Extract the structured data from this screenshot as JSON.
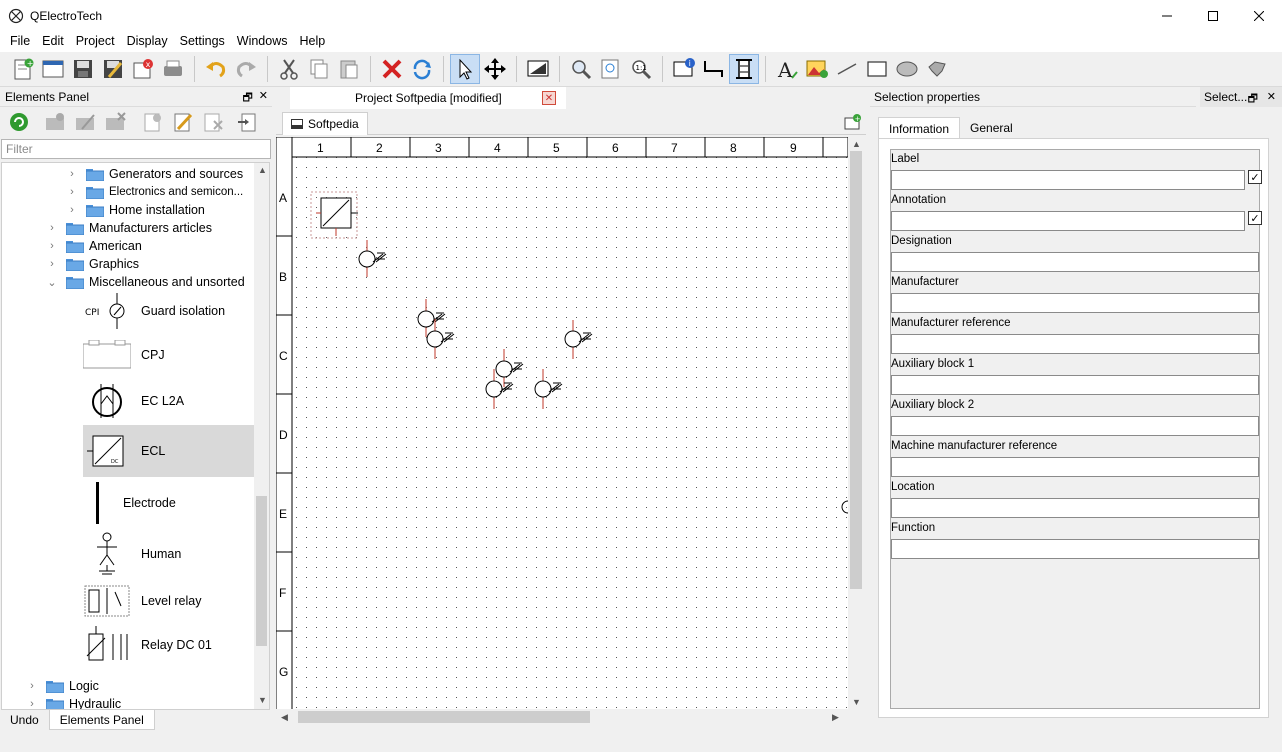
{
  "window": {
    "title": "QElectroTech"
  },
  "menu": [
    "File",
    "Edit",
    "Project",
    "Display",
    "Settings",
    "Windows",
    "Help"
  ],
  "toolbar": {
    "buttons": [
      "new-project-icon",
      "new-folio-icon",
      "save-icon",
      "save-as-icon",
      "close-icon",
      "print-icon",
      "undo-icon",
      "redo-icon",
      "cut-icon",
      "copy-icon",
      "paste-icon",
      "delete-icon",
      "rotate-icon",
      "select-icon",
      "move-icon",
      "fit-icon",
      "zoom-fit-icon",
      "zoom-reset-icon",
      "zoom-in-icon",
      "info-icon",
      "conductor-icon",
      "terminal-icon",
      "text-icon",
      "image-icon",
      "line-icon",
      "rectangle-icon",
      "ellipse-icon",
      "polygon-icon"
    ]
  },
  "elements_panel": {
    "title": "Elements Panel",
    "filter_placeholder": "Filter",
    "folders": [
      {
        "label": "Generators and sources",
        "level": 2,
        "expanded": false
      },
      {
        "label": "Electronics and semicon...",
        "level": 2,
        "expanded": false
      },
      {
        "label": "Home installation",
        "level": 2,
        "expanded": false
      },
      {
        "label": "Manufacturers articles",
        "level": 1,
        "expanded": false
      },
      {
        "label": "American",
        "level": 1,
        "expanded": false
      },
      {
        "label": "Graphics",
        "level": 1,
        "expanded": false
      },
      {
        "label": "Miscellaneous and unsorted",
        "level": 1,
        "expanded": true
      }
    ],
    "elements": [
      {
        "label": "Guard isolation",
        "thumb_text": "CPI"
      },
      {
        "label": "CPJ"
      },
      {
        "label": "EC L2A"
      },
      {
        "label": "ECL",
        "selected": true
      },
      {
        "label": "Electrode"
      },
      {
        "label": "Human"
      },
      {
        "label": "Level relay"
      },
      {
        "label": "Relay DC 01"
      }
    ],
    "bottom_folders": [
      "Logic",
      "Hydraulic"
    ]
  },
  "bottom_tabs": [
    "Undo",
    "Elements Panel"
  ],
  "document": {
    "tab_title": "Project Softpedia [modified]",
    "sheet_tab": "Softpedia",
    "columns": [
      "1",
      "2",
      "3",
      "4",
      "5",
      "6",
      "7",
      "8",
      "9"
    ],
    "rows": [
      "A",
      "B",
      "C",
      "D",
      "E",
      "F",
      "G"
    ]
  },
  "selection_panel": {
    "title": "Selection properties",
    "title_short": "Select...",
    "tabs": [
      "Information",
      "General"
    ],
    "fields": [
      "Label",
      "Annotation",
      "Designation",
      "Manufacturer",
      "Manufacturer reference",
      "Auxiliary block 1",
      "Auxiliary block 2",
      "Machine manufacturer reference",
      "Location",
      "Function"
    ]
  },
  "colors": {
    "accent_red": "#c0392b",
    "selection_blue": "#c9def5",
    "folder_blue": "#4a90d9"
  }
}
